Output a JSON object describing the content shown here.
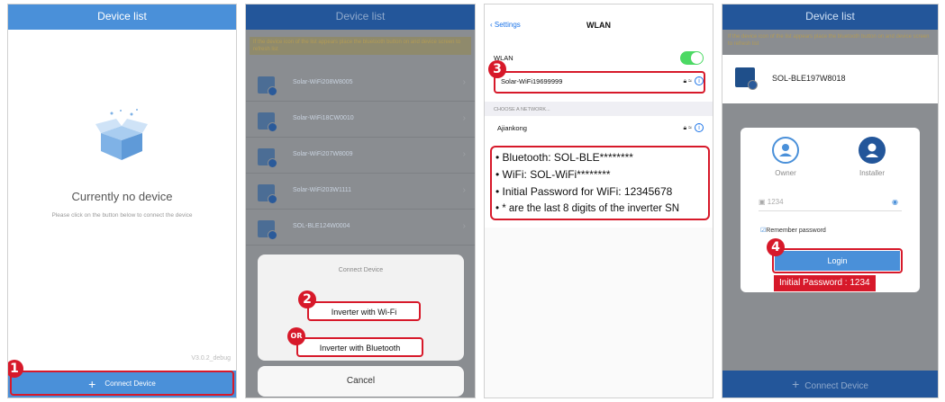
{
  "screen1": {
    "title": "Device list",
    "empty_title": "Currently no device",
    "empty_subtitle": "Please click on the button below to connect the device",
    "version": "V3.0.2_debug",
    "connect_label": "Connect Device",
    "step": "1"
  },
  "screen2": {
    "title": "Device list",
    "warning": "If the device icon of the list appears place the bluetooth button on and device screen to refresh list",
    "devices": [
      "Solar-WiFi208W8005",
      "Solar-WiFi18CW0010",
      "Solar-WiFi207W8009",
      "Solar-WiFi203W1111",
      "SOL-BLE124W0004"
    ],
    "sheet_title": "Connect Device",
    "option_wifi": "Inverter with Wi-Fi",
    "option_bluetooth": "Inverter with Bluetooth",
    "cancel": "Cancel",
    "step": "2",
    "or_label": "OR"
  },
  "screen3": {
    "back_label": "Settings",
    "title": "WLAN",
    "wlan_label": "WLAN",
    "connected_network": "Solar-WiFi19699999",
    "section_header": "CHOOSE A NETWORK...",
    "other_network": "Ajiankong",
    "step": "3",
    "notes": [
      "• Bluetooth: SOL-BLE********",
      "• WiFi: SOL-WiFi********",
      "• Initial Password for WiFi: 12345678",
      "• * are the last 8 digits of the inverter SN"
    ]
  },
  "screen4": {
    "title": "Device list",
    "warning": "If the device icon of the list appears place the bluetooth button on and device screen to refresh list",
    "device": "SOL-BLE197W8018",
    "role_owner": "Owner",
    "role_installer": "Installer",
    "password_value": "1234",
    "remember": "Remember password",
    "login": "Login",
    "initial_password_note": "Initial Password : 1234",
    "connect_label": "Connect Device",
    "step": "4"
  },
  "colors": {
    "accent": "#4a90d9",
    "highlight": "#d7192a",
    "toggle_on": "#4cd964"
  }
}
